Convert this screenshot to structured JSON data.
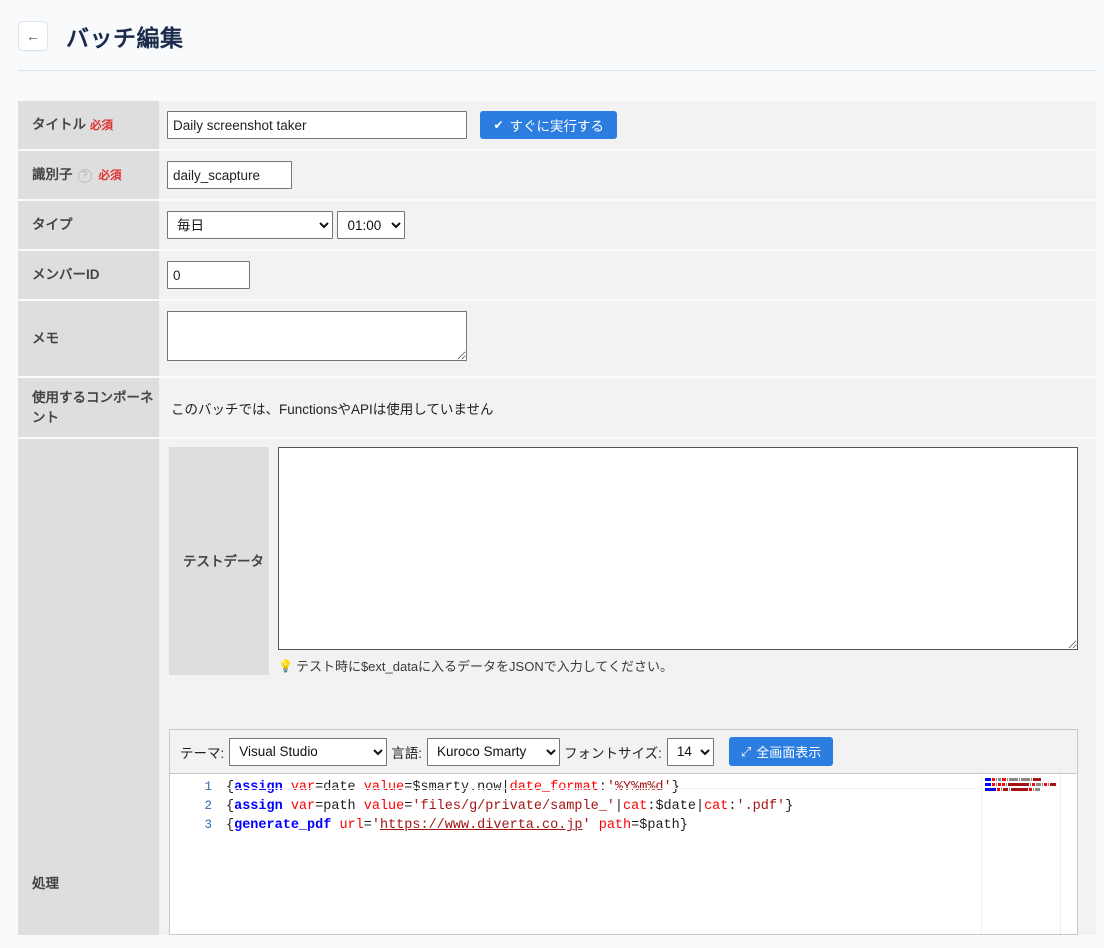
{
  "header": {
    "back_label": "←",
    "title": "バッチ編集"
  },
  "form": {
    "rows": {
      "title": {
        "label": "タイトル",
        "required": "必須",
        "value": "Daily screenshot taker",
        "run_now_button": "すぐに実行する",
        "run_now_icon": "check-icon"
      },
      "identifier": {
        "label": "識別子",
        "help_icon": "?",
        "required": "必須",
        "value": "daily_scapture"
      },
      "type": {
        "label": "タイプ",
        "schedule_value": "毎日",
        "schedule_options": [
          "毎日"
        ],
        "time_value": "01:00",
        "time_options": [
          "01:00"
        ]
      },
      "member_id": {
        "label": "メンバーID",
        "value": "0"
      },
      "memo": {
        "label": "メモ",
        "value": ""
      },
      "components": {
        "label": "使用するコンポーネント",
        "text": "このバッチでは、FunctionsやAPIは使用していません"
      },
      "process": {
        "label": "処理"
      }
    }
  },
  "testdata": {
    "label": "テストデータ",
    "value": "",
    "hint_icon": "lightbulb-icon",
    "hint": "テスト時に$ext_dataに入るデータをJSONで入力してください。"
  },
  "editor": {
    "theme_label": "テーマ:",
    "theme_value": "Visual Studio",
    "theme_options": [
      "Visual Studio"
    ],
    "language_label": "言語:",
    "language_value": "Kuroco Smarty",
    "language_options": [
      "Kuroco Smarty"
    ],
    "fontsize_label": "フォントサイズ:",
    "fontsize_value": "14",
    "fontsize_options": [
      "14"
    ],
    "fullscreen_label": "全画面表示",
    "fullscreen_icon": "expand-icon",
    "lines": [
      {
        "num": "1",
        "text": "{assign var=date value=$smarty.now|date_format:'%Y%m%d'}"
      },
      {
        "num": "2",
        "text": "{assign var=path value='files/g/private/sample_'|cat:$date|cat:'.pdf'}"
      },
      {
        "num": "3",
        "text": "{generate_pdf url='https://www.diverta.co.jp' path=$path}"
      }
    ]
  },
  "colors": {
    "accent_blue": "#2b7de0",
    "required_red": "#e03131",
    "header_bg": "#dedede",
    "row_bg": "#f2f2f2",
    "page_bg": "#f8fafc",
    "code_keyword": "#0000ff",
    "code_attr": "#ff0000",
    "code_string": "#a31515"
  }
}
